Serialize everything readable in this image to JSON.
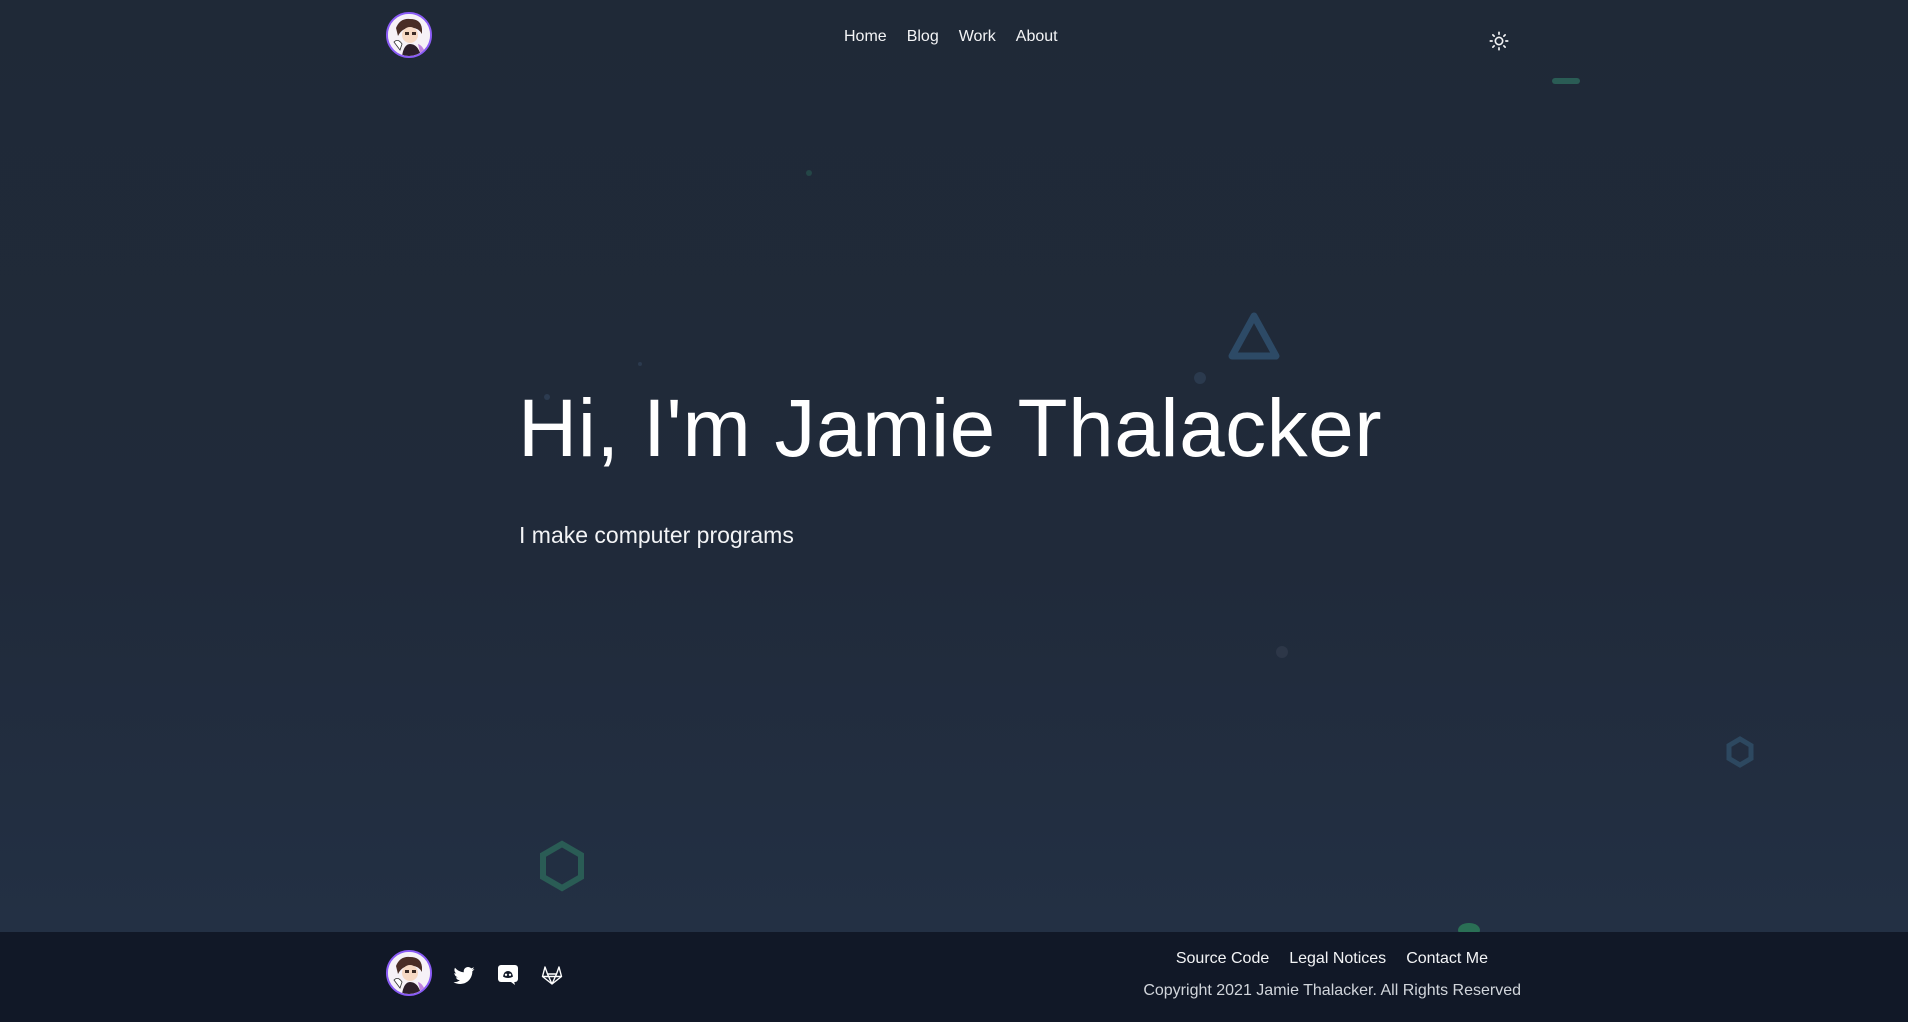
{
  "header": {
    "logo_alt": "Jamie Thalacker avatar",
    "nav": [
      {
        "label": "Home"
      },
      {
        "label": "Blog"
      },
      {
        "label": "Work"
      },
      {
        "label": "About"
      }
    ],
    "theme_toggle_icon": "sun-icon"
  },
  "hero": {
    "title": "Hi, I'm Jamie Thalacker",
    "subtitle": "I make computer programs"
  },
  "footer": {
    "social_icons": [
      "twitter-icon",
      "discord-icon",
      "gitlab-icon"
    ],
    "links": [
      {
        "label": "Source Code"
      },
      {
        "label": "Legal Notices"
      },
      {
        "label": "Contact Me"
      }
    ],
    "copyright": "Copyright 2021 Jamie Thalacker. All Rights Reserved"
  },
  "colors": {
    "background": "#1f2937",
    "footer_background": "#111827",
    "text": "#f3f4f6",
    "shape_teal": "#2f6f6a",
    "shape_blue": "#2d4a66",
    "avatar_ring": "#8b5cf6"
  }
}
